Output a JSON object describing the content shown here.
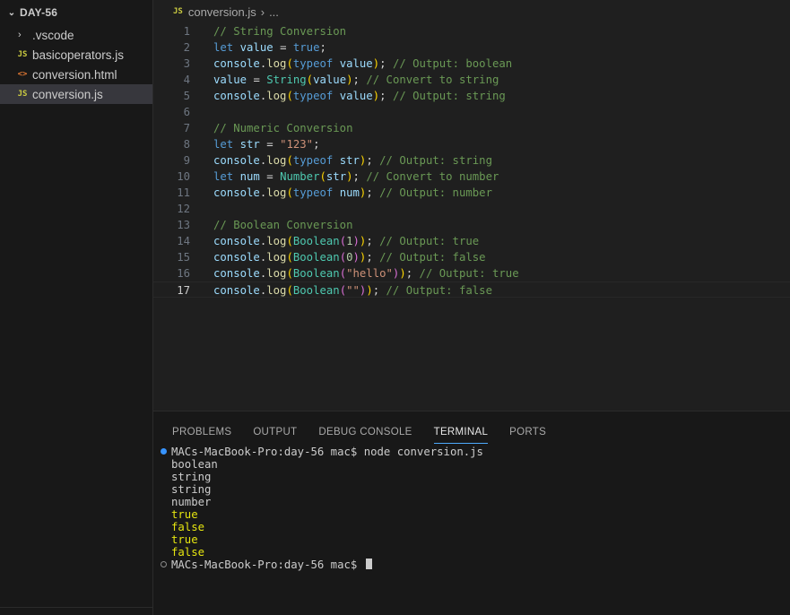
{
  "sidebar": {
    "title": "DAY-56",
    "items": [
      {
        "label": ".vscode",
        "type": "folder"
      },
      {
        "label": "basicoperators.js",
        "type": "js"
      },
      {
        "label": "conversion.html",
        "type": "html"
      },
      {
        "label": "conversion.js",
        "type": "js",
        "active": true
      }
    ]
  },
  "editor": {
    "breadcrumb": {
      "icon": "JS",
      "file": "conversion.js",
      "rest": "..."
    },
    "current_line": 17,
    "lines": [
      "// String Conversion",
      "let value = true;",
      "console.log(typeof value); // Output: boolean",
      "value = String(value); // Convert to string",
      "console.log(typeof value); // Output: string",
      "",
      "// Numeric Conversion",
      "let str = \"123\";",
      "console.log(typeof str); // Output: string",
      "let num = Number(str); // Convert to number",
      "console.log(typeof num); // Output: number",
      "",
      "// Boolean Conversion",
      "console.log(Boolean(1)); // Output: true",
      "console.log(Boolean(0)); // Output: false",
      "console.log(Boolean(\"hello\")); // Output: true",
      "console.log(Boolean(\"\")); // Output: false"
    ]
  },
  "panel": {
    "tabs": [
      "PROBLEMS",
      "OUTPUT",
      "DEBUG CONSOLE",
      "TERMINAL",
      "PORTS"
    ],
    "active_tab": "TERMINAL",
    "terminal": {
      "command_line": "MACs-MacBook-Pro:day-56 mac$ node conversion.js",
      "output": [
        "boolean",
        "string",
        "string",
        "number",
        "true",
        "false",
        "true",
        "false"
      ],
      "prompt": "MACs-MacBook-Pro:day-56 mac$ "
    }
  },
  "colors": {
    "accent": "#4daafc",
    "js_icon": "#cbcb41",
    "html_icon": "#e37933",
    "boolean_output": "#e5e510"
  }
}
